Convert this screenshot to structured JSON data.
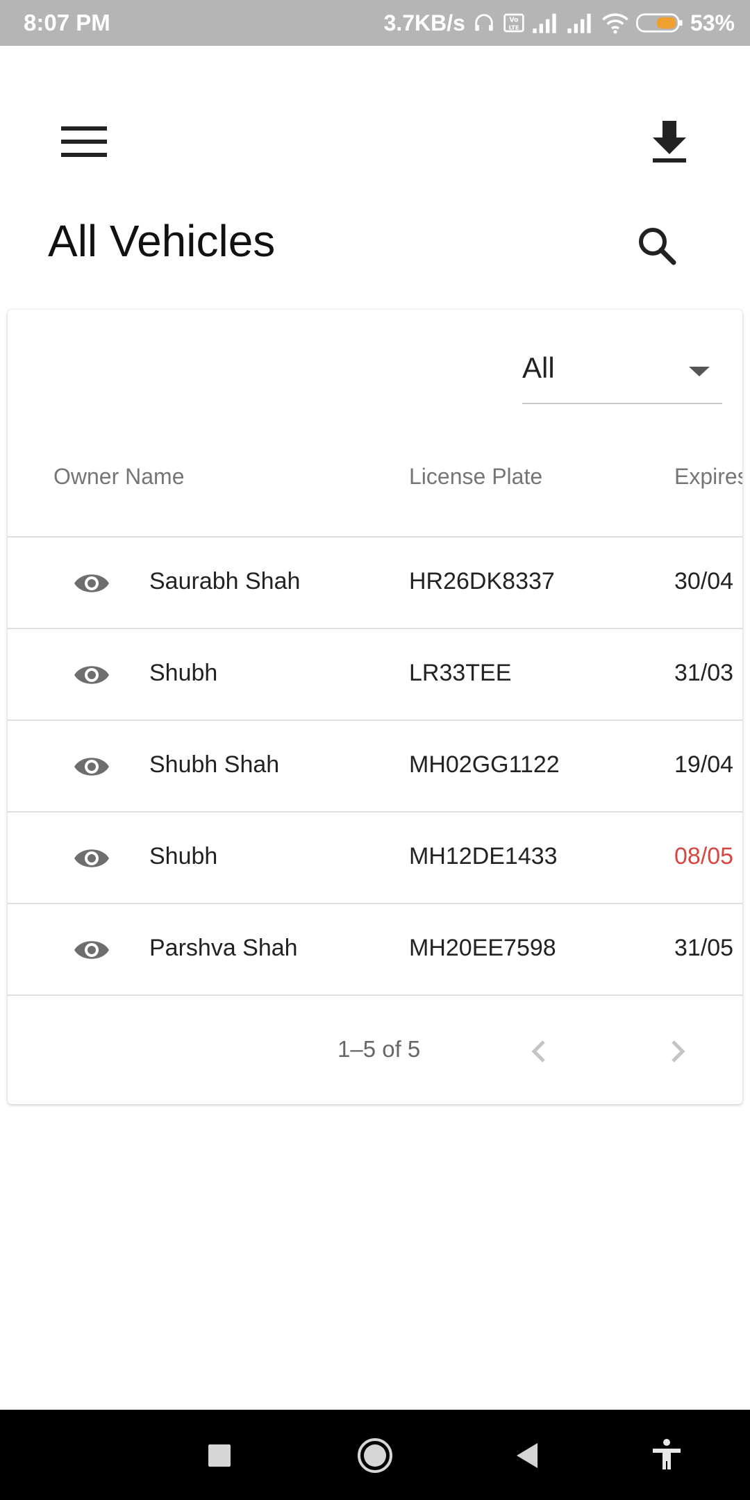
{
  "status_bar": {
    "time": "8:07 PM",
    "speed": "3.7KB/s",
    "battery": "53%",
    "icons": [
      "headphones-icon",
      "volte-icon",
      "signal-icon",
      "signal-icon",
      "wifi-icon",
      "battery-icon"
    ]
  },
  "header": {
    "title": "All Vehicles",
    "icons": [
      "menu-icon",
      "download-icon",
      "search-icon"
    ]
  },
  "filter": {
    "selected": "All"
  },
  "table": {
    "columns": [
      "Owner Name",
      "License Plate",
      "Expires"
    ],
    "rows": [
      {
        "owner": "Saurabh Shah",
        "plate": "HR26DK8337",
        "expires": "30/04",
        "expired": false
      },
      {
        "owner": "Shubh",
        "plate": "LR33TEE",
        "expires": "31/03",
        "expired": false
      },
      {
        "owner": "Shubh Shah",
        "plate": "MH02GG1122",
        "expires": "19/04",
        "expired": false
      },
      {
        "owner": "Shubh",
        "plate": "MH12DE1433",
        "expires": "08/05",
        "expired": true
      },
      {
        "owner": "Parshva Shah",
        "plate": "MH20EE7598",
        "expires": "31/05",
        "expired": false
      }
    ],
    "expired_color": "#d9453f"
  },
  "pagination": {
    "info": "1–5 of 5"
  },
  "nav_bar": {
    "icons": [
      "recents-square-icon",
      "home-circle-icon",
      "back-triangle-icon",
      "accessibility-icon"
    ]
  }
}
